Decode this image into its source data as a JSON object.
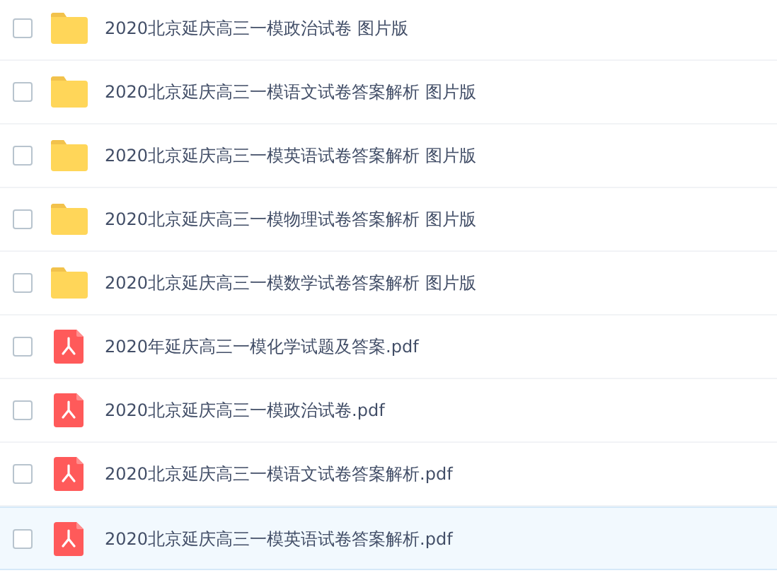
{
  "files": [
    {
      "kind": "folder",
      "name": "2020北京延庆高三一模政治试卷 图片版",
      "checked": false,
      "hovered": false
    },
    {
      "kind": "folder",
      "name": "2020北京延庆高三一模语文试卷答案解析 图片版",
      "checked": false,
      "hovered": false
    },
    {
      "kind": "folder",
      "name": "2020北京延庆高三一模英语试卷答案解析 图片版",
      "checked": false,
      "hovered": false
    },
    {
      "kind": "folder",
      "name": "2020北京延庆高三一模物理试卷答案解析 图片版",
      "checked": false,
      "hovered": false
    },
    {
      "kind": "folder",
      "name": "2020北京延庆高三一模数学试卷答案解析 图片版",
      "checked": false,
      "hovered": false
    },
    {
      "kind": "pdf",
      "name": "2020年延庆高三一模化学试题及答案.pdf",
      "checked": false,
      "hovered": false
    },
    {
      "kind": "pdf",
      "name": "2020北京延庆高三一模政治试卷.pdf",
      "checked": false,
      "hovered": false
    },
    {
      "kind": "pdf",
      "name": "2020北京延庆高三一模语文试卷答案解析.pdf",
      "checked": false,
      "hovered": false
    },
    {
      "kind": "pdf",
      "name": "2020北京延庆高三一模英语试卷答案解析.pdf",
      "checked": false,
      "hovered": true
    }
  ]
}
